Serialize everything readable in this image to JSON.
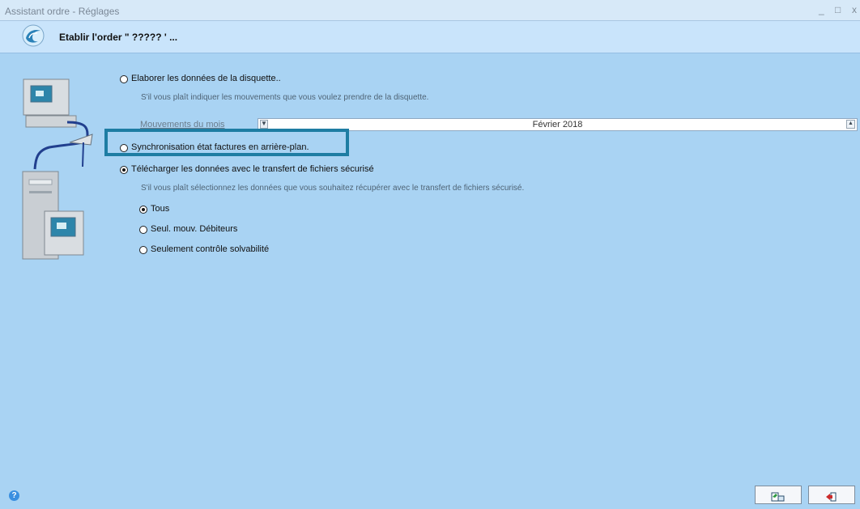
{
  "window": {
    "title": "Assistant ordre - Réglages",
    "controls": [
      "_",
      "□",
      "x"
    ]
  },
  "header": {
    "title": "Etablir l'order \" ????? ' ..."
  },
  "options": {
    "disk": {
      "label": "Elaborer les données de la disquette..",
      "hint": "S'il vous plaît indiquer les mouvements que vous voulez prendre de la disquette."
    },
    "month": {
      "label": "Mouvements du mois",
      "value": "Février  2018"
    },
    "sync": {
      "label": "Synchronisation état factures en arrière-plan."
    },
    "download": {
      "label": "Télécharger les données avec le transfert de fichiers sécurisé",
      "hint": "S'il vous plaît sélectionnez les données que vous souhaitez récupérer avec le transfert de fichiers sécurisé.",
      "sub": [
        "Tous",
        "Seul. mouv. Débiteurs",
        "Seulement contrôle solvabilité"
      ]
    }
  },
  "colors": {
    "background": "#a9d3f3",
    "header": "#c9e4fb",
    "highlight": "#1e7da3"
  },
  "icons": [
    "wave-logo-icon",
    "help-icon",
    "save-export-icon",
    "exit-icon"
  ]
}
